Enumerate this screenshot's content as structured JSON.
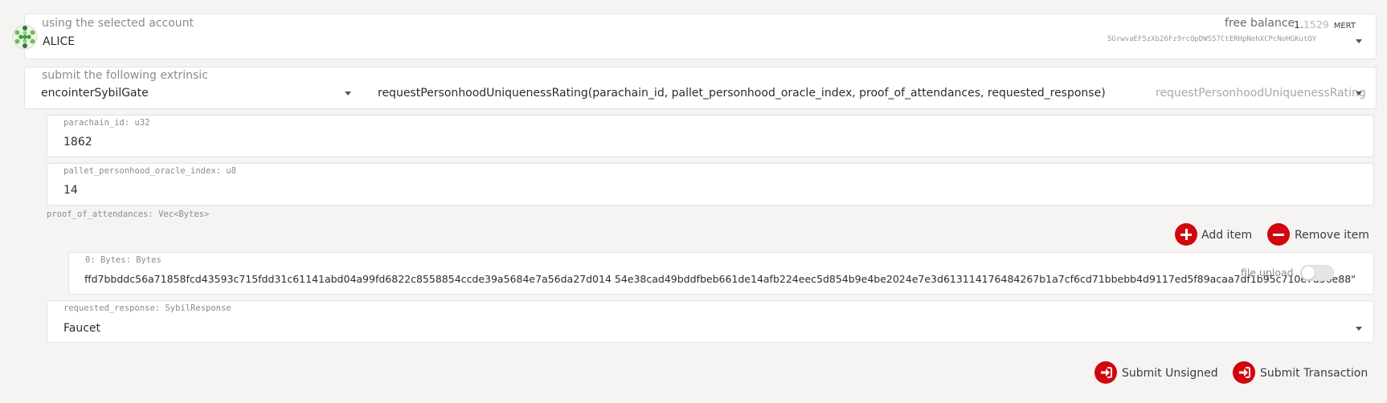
{
  "account": {
    "label": "using the selected account",
    "name": "ALICE",
    "balance_label": "free balance",
    "balance_int": "1.",
    "balance_dec": "1529",
    "balance_unit": "MERT",
    "address": "5GrwvaEF5zXb26Fz9rcQpDWS57CtERHpNehXCPcNoHGKutQY"
  },
  "extrinsic": {
    "label": "submit the following extrinsic",
    "pallet": "encointerSybilGate",
    "call_signature": "requestPersonhoodUniquenessRating(parachain_id, pallet_personhood_oracle_index, proof_of_attendances, requested_response)",
    "call_name": "requestPersonhoodUniquenessRating"
  },
  "params": {
    "parachain_id": {
      "label": "parachain_id: u32",
      "value": "1862"
    },
    "oracle_index": {
      "label": "pallet_personhood_oracle_index: u8",
      "value": "14"
    },
    "proofs": {
      "label": "proof_of_attendances: Vec<Bytes>",
      "add_label": "Add item",
      "remove_label": "Remove item",
      "item0": {
        "label": "0: Bytes: Bytes",
        "value": "ffd7bbddc56a71858fcd43593c715fdd31c61141abd04a99fd6822c8558854ccde39a5684e7a56da27d014 54e38cad49bddfbeb661de14afb224eec5d854b9e4be2024e7e3d613114176484267b1a7cf6cd71bbebb4d9117ed5f89acaa7df1b95c710e7a56e88\"",
        "file_upload_label": "file upload"
      }
    },
    "requested_response": {
      "label": "requested_response: SybilResponse",
      "value": "Faucet"
    }
  },
  "actions": {
    "submit_unsigned": "Submit Unsigned",
    "submit_transaction": "Submit Transaction"
  },
  "colors": {
    "accent": "#d1060f"
  }
}
